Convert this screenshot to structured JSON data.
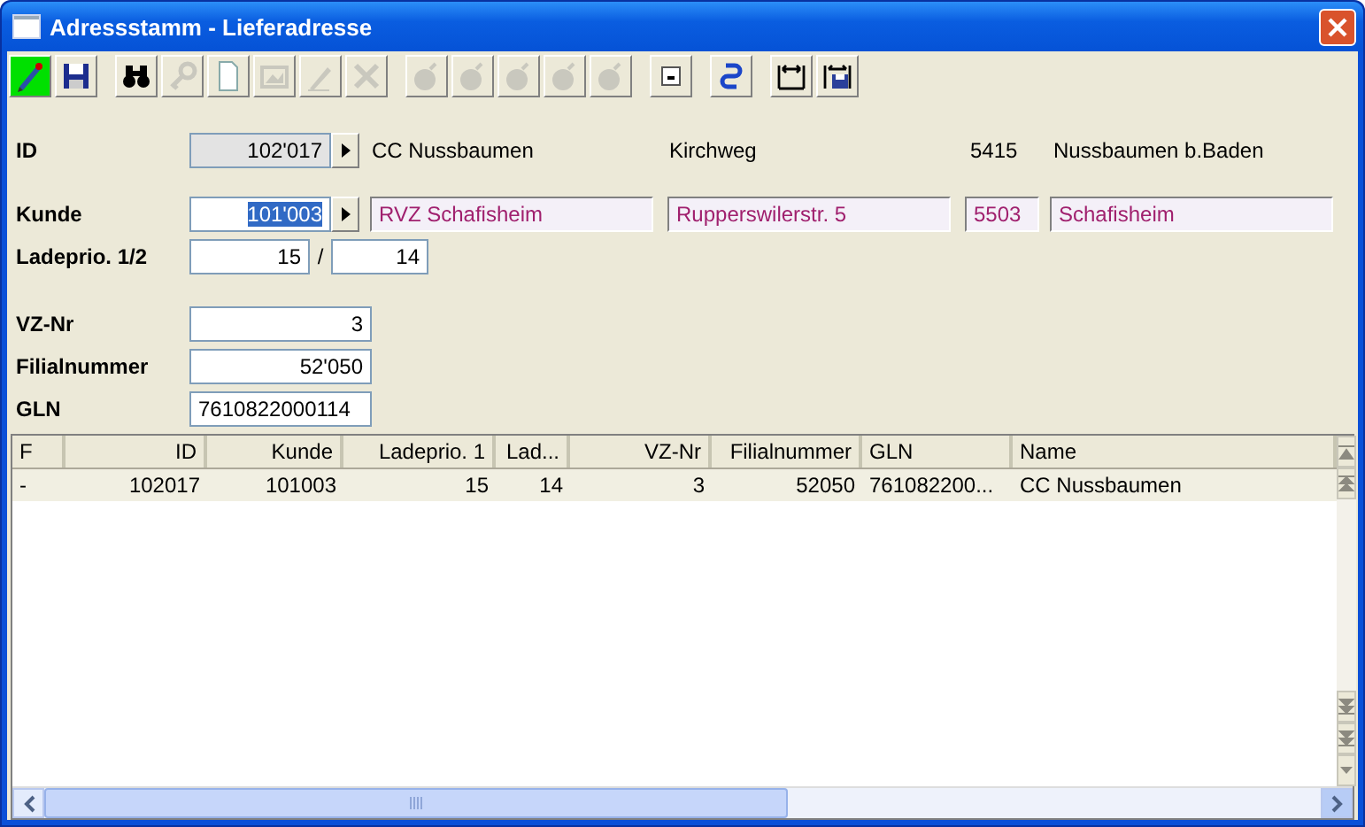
{
  "window": {
    "title": "Adressstamm - Lieferadresse"
  },
  "toolbar": [
    [
      {
        "disabled": false,
        "selected": true
      },
      {
        "disabled": false,
        "selected": false
      }
    ],
    [
      {
        "disabled": false,
        "selected": false
      },
      {
        "disabled": true,
        "selected": false
      },
      {
        "disabled": false,
        "selected": false
      },
      {
        "disabled": true,
        "selected": false
      },
      {
        "disabled": true,
        "selected": false
      },
      {
        "disabled": true,
        "selected": false
      }
    ],
    [
      {
        "disabled": true,
        "selected": false
      },
      {
        "disabled": true,
        "selected": false
      },
      {
        "disabled": true,
        "selected": false
      },
      {
        "disabled": true,
        "selected": false
      },
      {
        "disabled": true,
        "selected": false
      }
    ],
    [
      {
        "disabled": false,
        "selected": false
      }
    ],
    [
      {
        "disabled": false,
        "selected": false
      }
    ],
    [
      {
        "disabled": false,
        "selected": false
      },
      {
        "disabled": false,
        "selected": false
      }
    ]
  ],
  "form": {
    "id": {
      "label": "ID",
      "value": "102'017",
      "disabled": true,
      "selected": false,
      "info": [
        "CC Nussbaumen",
        "Kirchweg",
        "5415",
        "Nussbaumen b.Baden"
      ]
    },
    "kunde": {
      "label": "Kunde",
      "value": "101'003",
      "disabled": false,
      "selected": true,
      "linked": [
        "RVZ Schafisheim",
        "Rupperswilerstr. 5",
        "5503",
        "Schafisheim"
      ]
    },
    "ladeprio": {
      "label": "Ladeprio. 1/2",
      "value_1": "15",
      "separator": "/",
      "value_2": "14"
    },
    "fields": [
      {
        "label": "VZ-Nr",
        "value": "3",
        "numeric": true
      },
      {
        "label": "Filialnummer",
        "value": "52'050",
        "numeric": true
      },
      {
        "label": "GLN",
        "value": "7610822000114",
        "numeric": false
      }
    ]
  },
  "table": {
    "columns": [
      {
        "label": "F",
        "numeric": false
      },
      {
        "label": "ID",
        "numeric": true
      },
      {
        "label": "Kunde",
        "numeric": true
      },
      {
        "label": "Ladeprio. 1",
        "numeric": true
      },
      {
        "label": "Lad...",
        "numeric": true
      },
      {
        "label": "VZ-Nr",
        "numeric": true
      },
      {
        "label": "Filialnummer",
        "numeric": true
      },
      {
        "label": "GLN",
        "numeric": false
      },
      {
        "label": "Name",
        "numeric": false
      }
    ],
    "rows": [
      {
        "selected": true,
        "cells": [
          "-",
          "102017",
          "101003",
          "15",
          "14",
          "3",
          "52050",
          "761082200...",
          "CC Nussbaumen"
        ]
      }
    ]
  }
}
